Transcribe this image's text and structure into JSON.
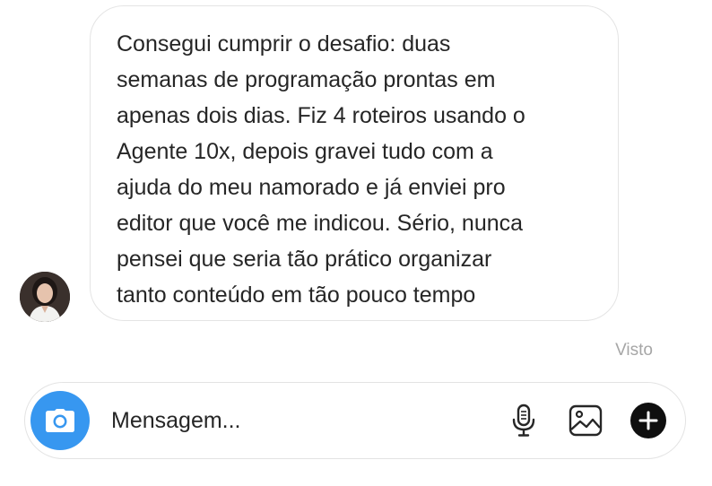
{
  "message": {
    "text": "Consegui cumprir o desafio: duas\nsemanas de programação prontas em\napenas dois dias. Fiz 4 roteiros usando o\nAgente 10x, depois gravei tudo com a\najuda do meu namorado e já enviei pro\neditor que você me indicou. Sério, nunca\npensei que seria tão prático organizar\ntanto conteúdo em tão pouco tempo"
  },
  "status": {
    "seen_label": "Visto"
  },
  "composer": {
    "placeholder": "Mensagem...",
    "icons": {
      "camera": "camera-icon",
      "mic": "microphone-icon",
      "gallery": "image-gallery-icon",
      "more": "plus-circle-icon"
    },
    "accent_color": "#3797f0"
  }
}
